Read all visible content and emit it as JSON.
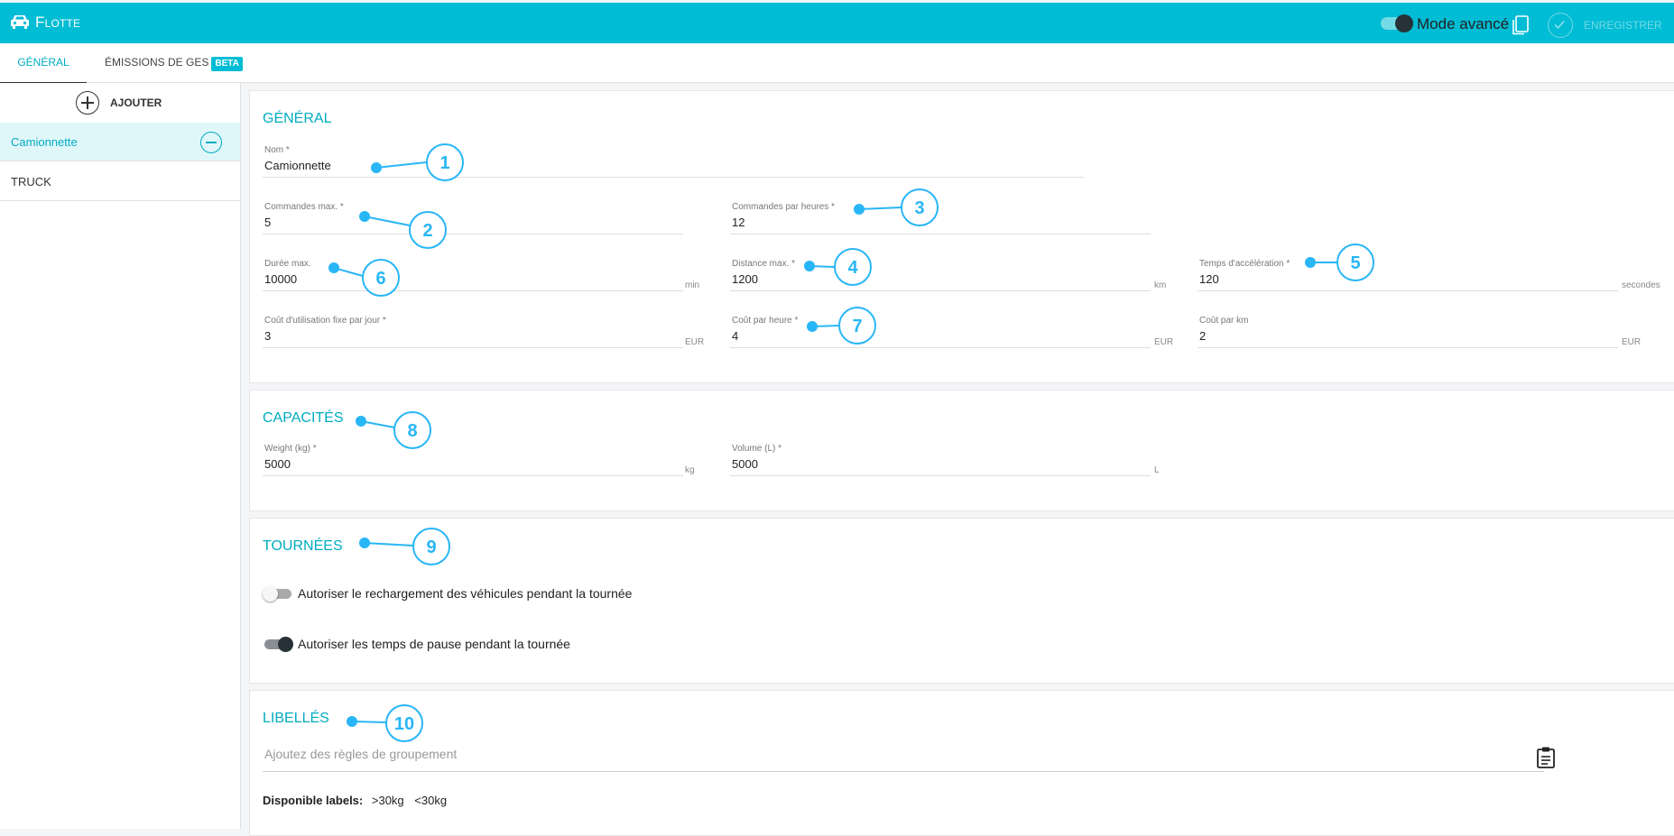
{
  "header": {
    "app_title": "Flotte",
    "mode_label": "Mode avancé",
    "save_label": "ENREGISTRER",
    "accent": "#00bcd4"
  },
  "tabs": [
    {
      "label": "Général",
      "active": true
    },
    {
      "label": "Émissions de GES",
      "badge": "BETA",
      "active": false
    }
  ],
  "sidebar": {
    "add_label": "AJOUTER",
    "vehicles": [
      {
        "name": "Camionnette",
        "selected": true
      },
      {
        "name": "TRUCK",
        "selected": false
      }
    ]
  },
  "general": {
    "title": "Général",
    "fields": {
      "nom": {
        "label": "Nom *",
        "value": "Camionnette"
      },
      "commandes_max": {
        "label": "Commandes max. *",
        "value": "5"
      },
      "commandes_heure": {
        "label": "Commandes par heures *",
        "value": "12"
      },
      "duree_max": {
        "label": "Durée max.",
        "value": "10000",
        "unit": "min"
      },
      "distance_max": {
        "label": "Distance max. *",
        "value": "1200",
        "unit": "km"
      },
      "acceleration": {
        "label": "Temps d'accélération *",
        "value": "120",
        "unit": "secondes"
      },
      "cout_fixe": {
        "label": "Coût d'utilisation fixe par jour *",
        "value": "3",
        "unit": "EUR"
      },
      "cout_heure": {
        "label": "Coût par heure *",
        "value": "4",
        "unit": "EUR"
      },
      "cout_km": {
        "label": "Coût par km",
        "value": "2",
        "unit": "EUR"
      }
    }
  },
  "capacites": {
    "title": "Capacités",
    "weight": {
      "label": "Weight (kg) *",
      "value": "5000",
      "unit": "kg"
    },
    "volume": {
      "label": "Volume (L) *",
      "value": "5000",
      "unit": "L"
    }
  },
  "tournees": {
    "title": "Tournées",
    "recharge": {
      "label": "Autoriser le rechargement des véhicules pendant la tournée",
      "on": false
    },
    "pause": {
      "label": "Autoriser les temps de pause pendant la tournée",
      "on": true
    }
  },
  "libelles": {
    "title": "Libellés",
    "placeholder": "Ajoutez des règles de groupement",
    "available_label": "Disponible labels:",
    "labels": [
      ">30kg",
      "<30kg"
    ]
  },
  "callouts": [
    "1",
    "2",
    "3",
    "4",
    "5",
    "6",
    "7",
    "8",
    "9",
    "10"
  ]
}
